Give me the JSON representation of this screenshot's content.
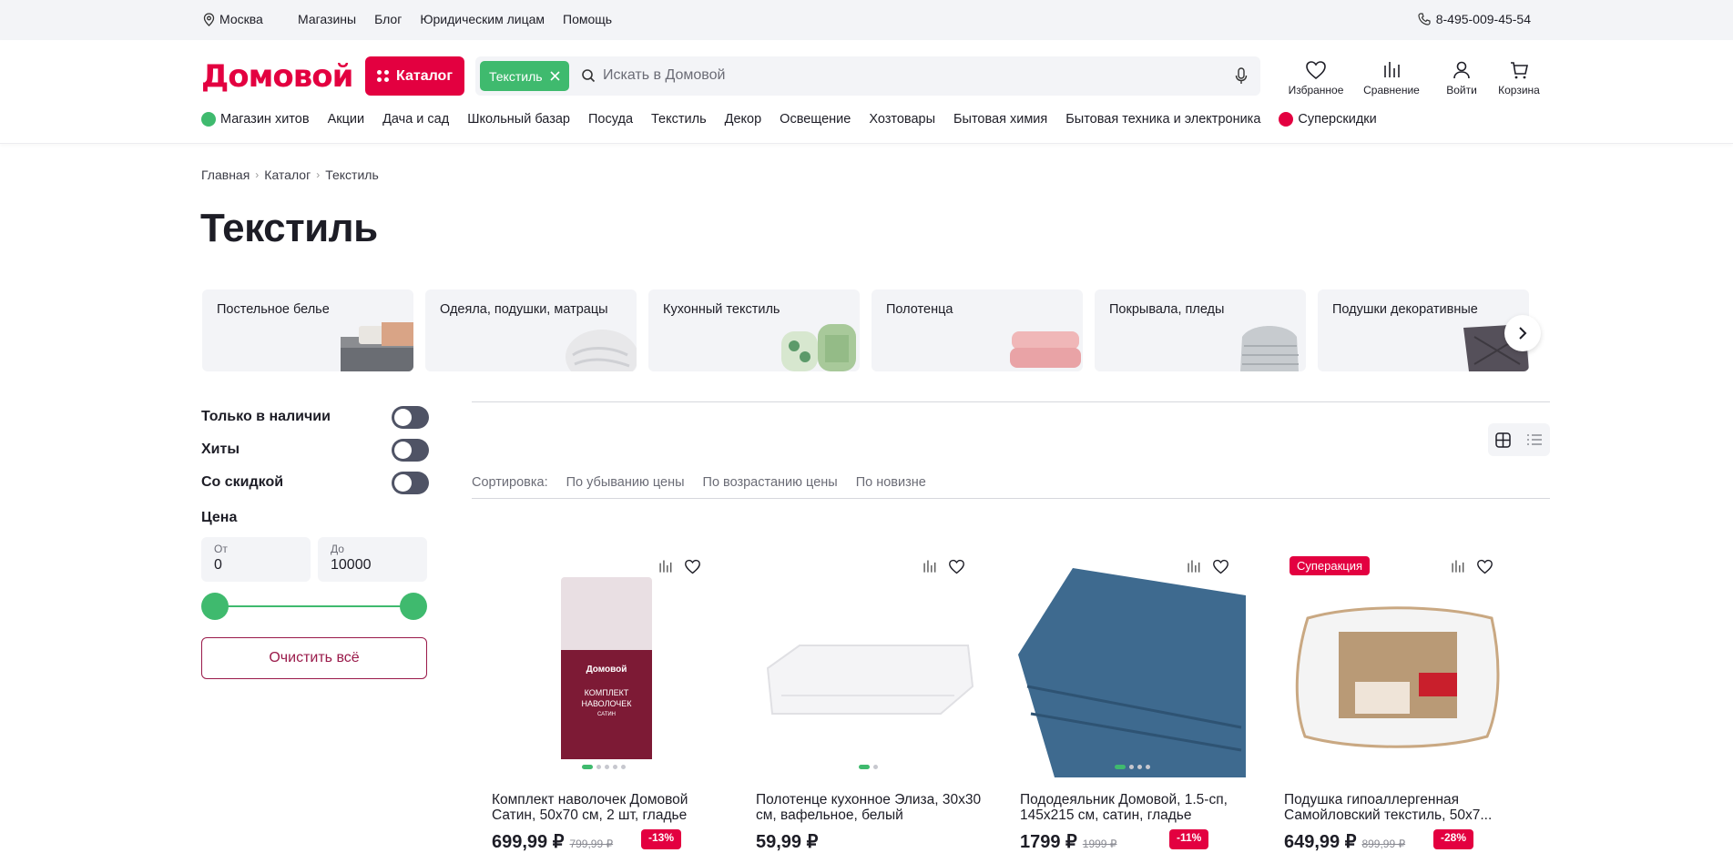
{
  "topbar": {
    "city": "Москва",
    "links": [
      "Магазины",
      "Блог",
      "Юридическим лицам",
      "Помощь"
    ],
    "phone": "8-495-009-45-54"
  },
  "header": {
    "logo": "Домовой",
    "catalog_label": "Каталог",
    "search_chip": "Текстиль",
    "search_placeholder": "Искать в Домовой",
    "actions": [
      "Избранное",
      "Сравнение",
      "Войти",
      "Корзина"
    ]
  },
  "nav": {
    "hits": "Магазин хитов",
    "items": [
      "Акции",
      "Дача и сад",
      "Школьный базар",
      "Посуда",
      "Текстиль",
      "Декор",
      "Освещение",
      "Хозтовары",
      "Бытовая химия",
      "Бытовая техника и электроника"
    ],
    "super": "Суперскидки"
  },
  "breadcrumb": [
    "Главная",
    "Каталог",
    "Текстиль"
  ],
  "page_title": "Текстиль",
  "categories": [
    "Постельное белье",
    "Одеяла, подушки, матрацы",
    "Кухонный текстиль",
    "Полотенца",
    "Покрывала, пледы",
    "Подушки декоративные"
  ],
  "filters": {
    "in_stock": "Только в наличии",
    "hits": "Хиты",
    "discount": "Со скидкой",
    "price_title": "Цена",
    "from_label": "От",
    "from_value": "0",
    "to_label": "До",
    "to_value": "10000",
    "clear": "Очистить всё"
  },
  "sort": {
    "label": "Сортировка:",
    "options": [
      "По убыванию цены",
      "По возрастанию цены",
      "По новизне"
    ]
  },
  "products": [
    {
      "name": "Комплект наволочек Домовой Сатин, 50х70 см, 2 шт, гладье",
      "price": "699,99 ₽",
      "old": "799,99 ₽",
      "discount": "-13%"
    },
    {
      "name": "Полотенце кухонное Элиза, 30х30 см, вафельное, белый",
      "price": "59,99 ₽",
      "old": "",
      "discount": ""
    },
    {
      "name": "Пододеяльник Домовой, 1.5-сп, 145х215 см, сатин, гладье",
      "price": "1799 ₽",
      "old": "1999 ₽",
      "discount": "-11%"
    },
    {
      "name": "Подушка гипоаллергенная Самойловский текстиль, 50х7...",
      "price": "649,99 ₽",
      "old": "899,99 ₽",
      "discount": "-28%",
      "badge": "Суперакция"
    }
  ],
  "package_text": {
    "brand": "Домовой",
    "line1": "КОМПЛЕКТ",
    "line2": "НАВОЛОЧЕК",
    "line3": "САТИН"
  },
  "colors": {
    "brand_red": "#e30040",
    "accent_green": "#3fba6e",
    "bg_gray": "#f3f4f7"
  }
}
